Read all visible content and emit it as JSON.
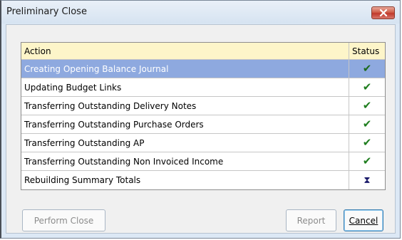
{
  "window": {
    "title": "Preliminary Close",
    "close_icon": "close-icon"
  },
  "grid": {
    "columns": {
      "action": "Action",
      "status": "Status"
    },
    "rows": [
      {
        "action": "Creating Opening Balance Journal",
        "status": "✔",
        "status_icon": "checkmark-icon",
        "selected": true
      },
      {
        "action": "Updating Budget Links",
        "status": "✔",
        "status_icon": "checkmark-icon"
      },
      {
        "action": "Transferring Outstanding Delivery Notes",
        "status": "✔",
        "status_icon": "checkmark-icon"
      },
      {
        "action": "Transferring Outstanding Purchase Orders",
        "status": "✔",
        "status_icon": "checkmark-icon"
      },
      {
        "action": "Transferring Outstanding AP",
        "status": "✔",
        "status_icon": "checkmark-icon"
      },
      {
        "action": "Transferring Outstanding Non Invoiced Income",
        "status": "✔",
        "status_icon": "checkmark-icon"
      },
      {
        "action": "Rebuilding Summary Totals",
        "status": "⧗",
        "status_icon": "hourglass-icon"
      }
    ]
  },
  "buttons": {
    "perform_close": "Perform Close",
    "report": "Report",
    "cancel": "Cancel"
  },
  "colors": {
    "selected_row": "#8ea9df",
    "header_row": "#fdf5c9",
    "check_green": "#1e7d1e",
    "close_red": "#c0392b"
  }
}
